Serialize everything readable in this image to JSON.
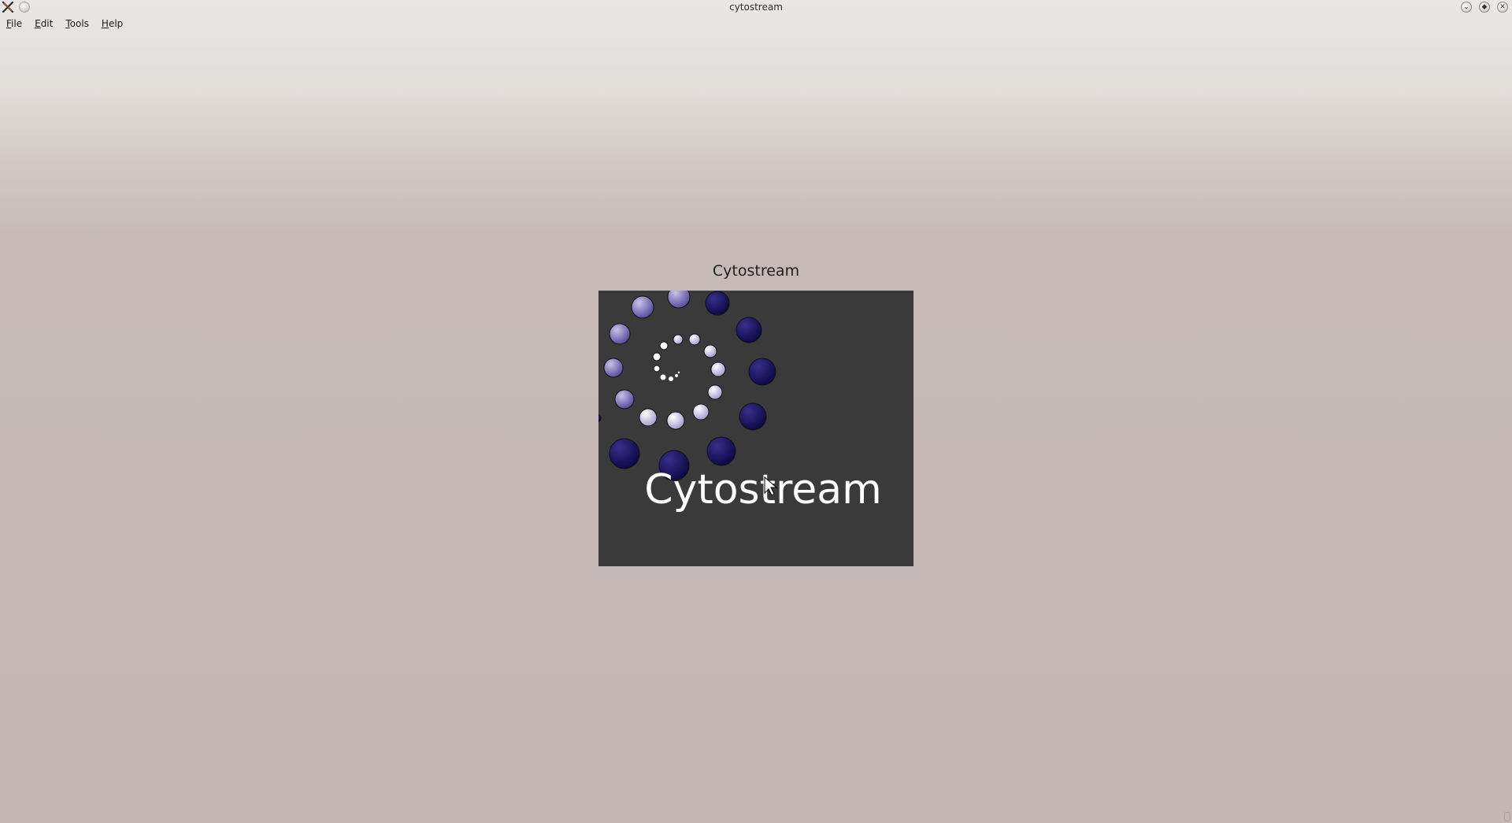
{
  "window": {
    "title": "cytostream",
    "app_icon": "x-app-icon",
    "controls": [
      "minimize-icon",
      "maximize-icon",
      "close-icon"
    ]
  },
  "menubar": {
    "items": [
      {
        "label": "File",
        "mnemonic": "F",
        "rest": "ile"
      },
      {
        "label": "Edit",
        "mnemonic": "E",
        "rest": "dit"
      },
      {
        "label": "Tools",
        "mnemonic": "T",
        "rest": "ools"
      },
      {
        "label": "Help",
        "mnemonic": "H",
        "rest": "elp"
      }
    ]
  },
  "splash": {
    "caption": "Cytostream",
    "logo_text": "Cytostream",
    "background": "#3a3a3a",
    "sphere_color_dark": "#0d0650",
    "sphere_color_light": "#b8b0d8"
  }
}
